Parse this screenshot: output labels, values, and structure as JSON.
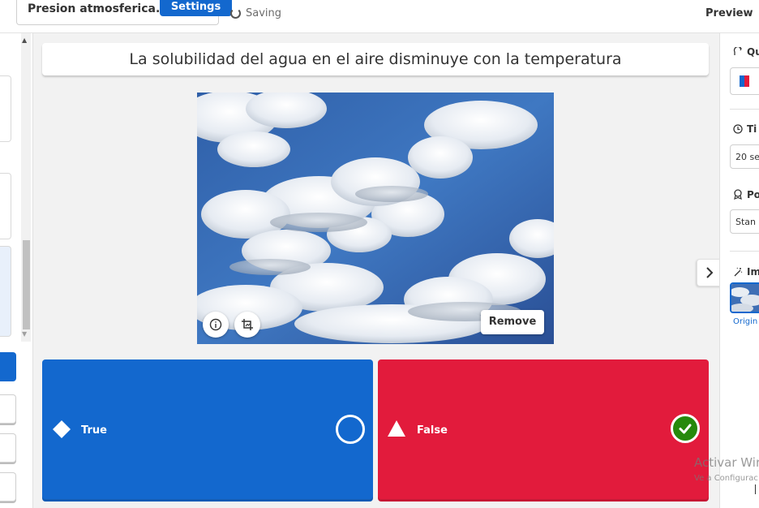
{
  "header": {
    "quiz_title": "Presion atmosferica.",
    "settings_label": "Settings",
    "saving_label": "Saving",
    "preview_label": "Preview"
  },
  "question": {
    "text": "La solubilidad del agua en el aire disminuye con la temperatura"
  },
  "media": {
    "remove_label": "Remove",
    "info_icon": "info-icon",
    "crop_icon": "crop-icon"
  },
  "answers": [
    {
      "label": "True",
      "shape": "diamond",
      "color": "#1368ce",
      "correct": false
    },
    {
      "label": "False",
      "shape": "triangle",
      "color": "#e21b3c",
      "correct": true
    }
  ],
  "right_panel": {
    "question_type_heading": "Qu",
    "time_limit_heading": "Ti",
    "time_limit_value": "20 se",
    "points_heading": "Po",
    "points_value": "Stan",
    "image_reveal_heading": "Im",
    "image_reveal_option": "Origin"
  },
  "watermark": {
    "line1": "Activar Wir",
    "line2": "Ve a Configurac"
  },
  "colors": {
    "brand_blue": "#1368ce",
    "answer_red": "#e21b3c",
    "correct_green": "#26890c"
  }
}
